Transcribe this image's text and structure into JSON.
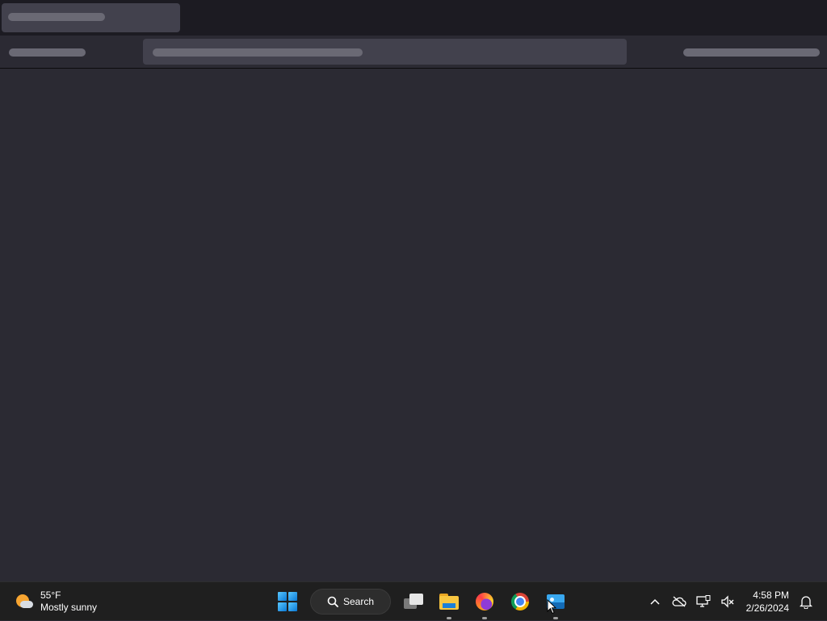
{
  "browser": {
    "state": "loading-skeleton"
  },
  "taskbar": {
    "weather": {
      "temperature": "55°F",
      "condition": "Mostly sunny",
      "icon": "partly-sunny-icon"
    },
    "search": {
      "label": "Search"
    },
    "pinned_apps": [
      {
        "name": "Task View",
        "icon": "task-view-icon"
      },
      {
        "name": "File Explorer",
        "icon": "file-explorer-icon",
        "running": true
      },
      {
        "name": "Firefox",
        "icon": "firefox-icon",
        "running": true
      },
      {
        "name": "Google Chrome",
        "icon": "chrome-icon"
      },
      {
        "name": "Photos",
        "icon": "photos-icon",
        "running": true
      }
    ],
    "tray": {
      "icons": [
        "chevron-up-icon",
        "onedrive-offline-icon",
        "network-icon",
        "volume-muted-icon"
      ],
      "time": "4:58 PM",
      "date": "2/26/2024",
      "notification_icon": "bell-icon"
    }
  },
  "colors": {
    "chrome_bg": "#1c1b22",
    "content_bg": "#2b2a33",
    "skeleton": "#6a6974",
    "taskbar_bg": "#1f1f1f"
  }
}
